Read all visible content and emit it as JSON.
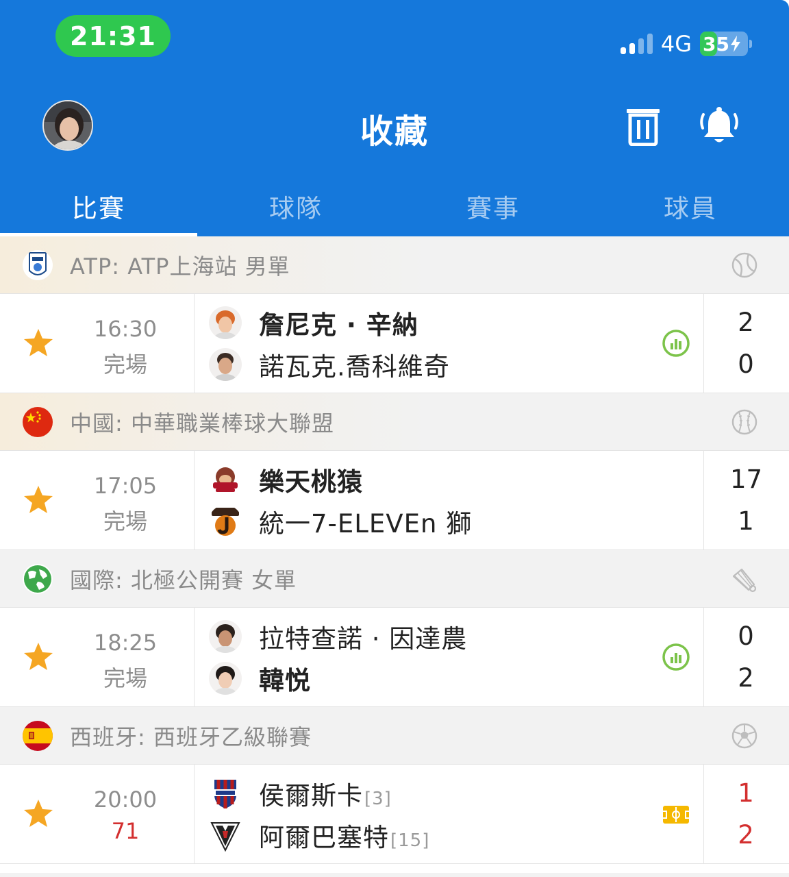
{
  "status_bar": {
    "time": "21:31",
    "network": "4G",
    "battery": "35"
  },
  "header": {
    "title": "收藏"
  },
  "tabs": [
    {
      "label": "比賽",
      "active": true
    },
    {
      "label": "球隊",
      "active": false
    },
    {
      "label": "賽事",
      "active": false
    },
    {
      "label": "球員",
      "active": false
    }
  ],
  "sections": [
    {
      "league": "ATP: ATP上海站 男單",
      "sport_icon": "tennis-ball-icon",
      "match": {
        "time": "16:30",
        "status": "完場",
        "live": false,
        "home": {
          "name": "詹尼克 · 辛納",
          "rank": "",
          "winner": true
        },
        "away": {
          "name": "諾瓦克.喬科維奇",
          "rank": "",
          "winner": false
        },
        "home_score": "2",
        "away_score": "0",
        "side_icon": "stats-icon"
      }
    },
    {
      "league": "中國: 中華職業棒球大聯盟",
      "sport_icon": "baseball-icon",
      "match": {
        "time": "17:05",
        "status": "完場",
        "live": false,
        "home": {
          "name": "樂天桃猿",
          "rank": "",
          "winner": true
        },
        "away": {
          "name": "統一7-ELEVEn 獅",
          "rank": "",
          "winner": false
        },
        "home_score": "17",
        "away_score": "1",
        "side_icon": ""
      }
    },
    {
      "league": "國際: 北極公開賽 女單",
      "sport_icon": "shuttlecock-icon",
      "match": {
        "time": "18:25",
        "status": "完場",
        "live": false,
        "home": {
          "name": "拉特查諾 · 因達農",
          "rank": "",
          "winner": false
        },
        "away": {
          "name": "韓悦",
          "rank": "",
          "winner": true
        },
        "home_score": "0",
        "away_score": "2",
        "side_icon": "stats-icon"
      }
    },
    {
      "league": "西班牙: 西班牙乙級聯賽",
      "sport_icon": "soccer-ball-icon",
      "match": {
        "time": "20:00",
        "status": "71",
        "live": true,
        "home": {
          "name": "侯爾斯卡",
          "rank": "[3]",
          "winner": false
        },
        "away": {
          "name": "阿爾巴塞特",
          "rank": "[15]",
          "winner": false
        },
        "home_score": "1",
        "away_score": "2",
        "side_icon": "pitch-icon"
      }
    }
  ],
  "colors": {
    "header_bg": "#1578DB",
    "star": "#F5A623",
    "live": "#D32F2F",
    "stats": "#7CC34A",
    "pitch": "#F5B800"
  }
}
